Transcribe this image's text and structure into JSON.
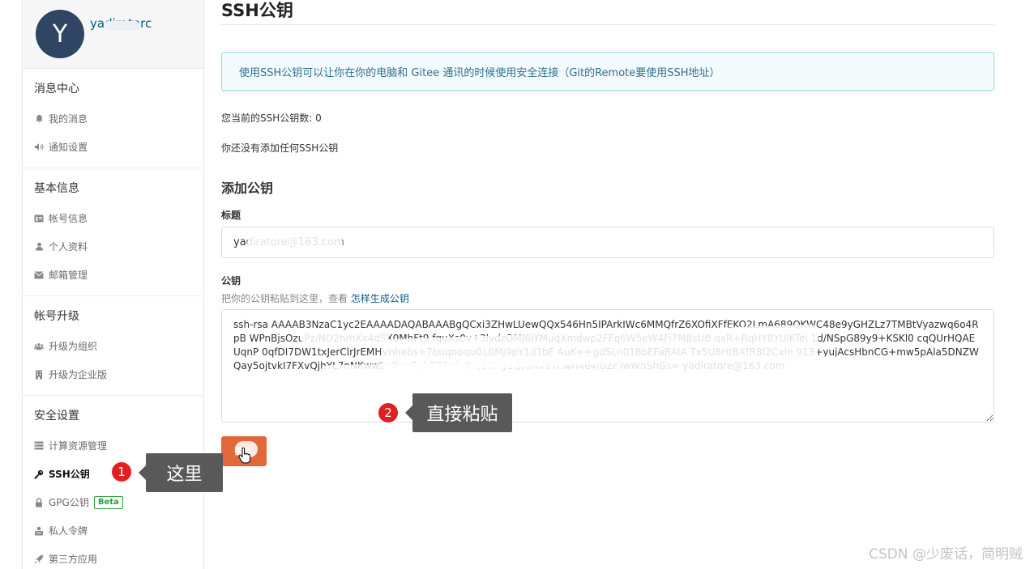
{
  "user": {
    "avatar_letter": "Y",
    "name": "yadiratorc"
  },
  "sidebar": {
    "sections": [
      {
        "title": "消息中心",
        "items": [
          {
            "label": "我的消息",
            "icon": "bell-icon"
          },
          {
            "label": "通知设置",
            "icon": "volume-icon"
          }
        ]
      },
      {
        "title": "基本信息",
        "items": [
          {
            "label": "帐号信息",
            "icon": "id-card-icon"
          },
          {
            "label": "个人资料",
            "icon": "user-icon"
          },
          {
            "label": "邮箱管理",
            "icon": "envelope-icon"
          }
        ]
      },
      {
        "title": "帐号升级",
        "items": [
          {
            "label": "升级为组织",
            "icon": "users-icon"
          },
          {
            "label": "升级为企业版",
            "icon": "building-icon"
          }
        ]
      },
      {
        "title": "安全设置",
        "items": [
          {
            "label": "计算资源管理",
            "icon": "server-icon"
          },
          {
            "label": "SSH公钥",
            "icon": "key-icon"
          },
          {
            "label": "GPG公钥",
            "icon": "lock-icon"
          },
          {
            "label": "私人令牌",
            "icon": "token-icon"
          },
          {
            "label": "第三方应用",
            "icon": "rocket-icon"
          }
        ]
      }
    ],
    "beta_label": "Beta"
  },
  "main": {
    "title": "SSH公钥",
    "info": "使用SSH公钥可以让你在你的电脑和 Gitee 通讯的时候使用安全连接（Git的Remote要使用SSH地址）",
    "count_text": "您当前的SSH公钥数: 0",
    "empty_text": "你还没有添加任何SSH公钥",
    "add_title": "添加公钥",
    "title_label": "标题",
    "title_value": "yadiratore@163.com",
    "key_label": "公钥",
    "hint_text": "把你的公钥粘贴到这里，查看 ",
    "hint_link": "怎样生成公钥",
    "key_value": "ssh-rsa AAAAB3NzaC1yc2EAAAADAQABAAABgQCxi3ZHwLUewQQx546Hn5IPArkIWc6MMQfrZ6XOfiXFfEKO2LmA689QKWC48e9yGHZLz7TMBtVyazwq6o4RpB WPnBjsOzuPz/NO2hmXx4dSX0MhFt9 fquXs0v+3lvdzOMJ6iYMuqXmdwp2FFq6W5eW4Fi7M8sUB qxR+RqHY8YUlKTel 1d/NSpG89y9+KSKl0 cqQUrHQAEUqnP 0qfDI7DW1txJerClrJrEMHVnhebs+7buqooquGL0Mj9pY1d1bF AuK++gdSLn018bEFaRAIA Tx5U8HtBXfR8f2Cxln 913+yujAcsHbnCG+mw5pAla5DNZWQay5ojtvkI7FXvQjhYL7nNKww2uBqnBqk773Hih8rq6KY y1Q/UHv9TCwH4e4lUZFTwW5ShGs= yadiratore@163.com",
    "confirm_label": "确定"
  },
  "annotations": {
    "badge1": "1",
    "label1": "这里",
    "badge2": "2",
    "label2": "直接粘贴"
  },
  "watermark": "CSDN @少废话，简明贼"
}
